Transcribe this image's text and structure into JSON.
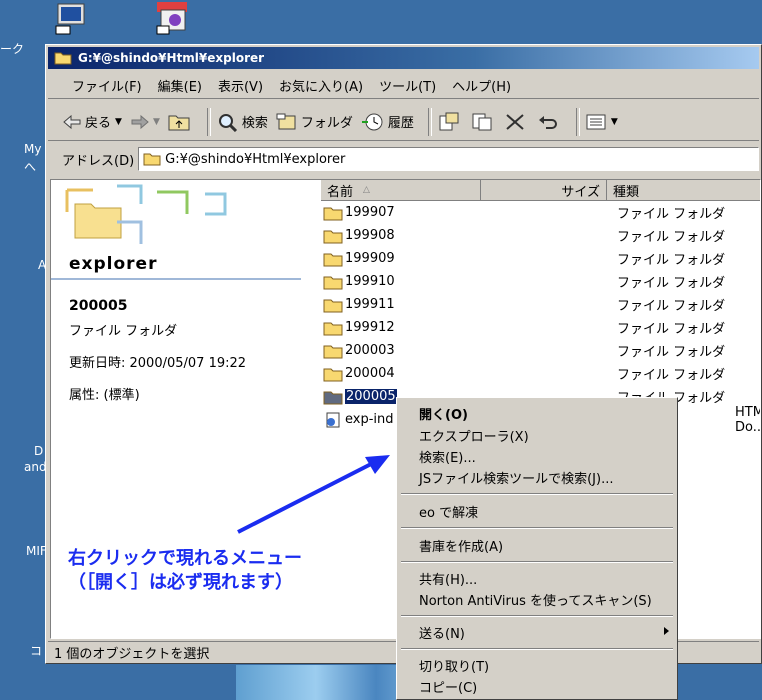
{
  "desktop": {
    "labels": [
      "ーク",
      "My",
      "へ",
      "A",
      "D",
      "and",
      "MIF",
      "コ"
    ]
  },
  "window": {
    "title": "G:¥@shindo¥Html¥explorer"
  },
  "menu": [
    "ファイル(F)",
    "編集(E)",
    "表示(V)",
    "お気に入り(A)",
    "ツール(T)",
    "ヘルプ(H)"
  ],
  "toolbar": {
    "back": "戻る",
    "search": "検索",
    "folders": "フォルダ",
    "history": "履歴"
  },
  "address": {
    "label": "アドレス(D)",
    "value": "G:¥@shindo¥Html¥explorer"
  },
  "leftpane": {
    "folder_name": "explorer",
    "selected_name": "200005",
    "selected_type": "ファイル フォルダ",
    "modified": "更新日時: 2000/05/07 19:22",
    "attributes": "属性: (標準)"
  },
  "columns": {
    "name": "名前",
    "size": "サイズ",
    "type": "種類"
  },
  "rows": [
    {
      "name": "199907",
      "type": "ファイル フォルダ"
    },
    {
      "name": "199908",
      "type": "ファイル フォルダ"
    },
    {
      "name": "199909",
      "type": "ファイル フォルダ"
    },
    {
      "name": "199910",
      "type": "ファイル フォルダ"
    },
    {
      "name": "199911",
      "type": "ファイル フォルダ"
    },
    {
      "name": "199912",
      "type": "ファイル フォルダ"
    },
    {
      "name": "200003",
      "type": "ファイル フォルダ"
    },
    {
      "name": "200004",
      "type": "ファイル フォルダ"
    },
    {
      "name": "200005",
      "type": "ファイル フォルダ"
    },
    {
      "name": "exp-ind",
      "type": "HTML Do..."
    }
  ],
  "status": "1 個のオブジェクトを選択",
  "context_menu": {
    "open": "開く(O)",
    "explorer": "エクスプローラ(X)",
    "search": "検索(E)...",
    "js_search": "JSファイル検索ツールで検索(J)...",
    "eo": "eo で解凍",
    "archive": "書庫を作成(A)",
    "share": "共有(H)...",
    "norton": "Norton AntiVirus を使ってスキャン(S)",
    "send_to": "送る(N)",
    "cut": "切り取り(T)",
    "copy": "コピー(C)"
  },
  "annotation": {
    "line1": "右クリックで現れるメニュー",
    "line2": "（［開く］は必ず現れます）"
  },
  "colors": {
    "desktop": "#3a6ea5",
    "title_bar": "#0a246a",
    "annotation": "#1a2cf0",
    "selection": "#0a246a"
  }
}
